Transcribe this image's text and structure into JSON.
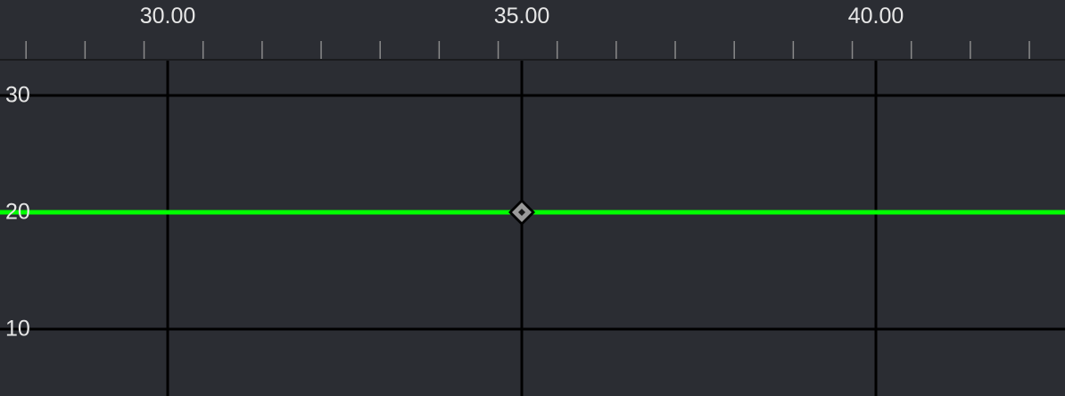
{
  "timeline": {
    "ruler_labels": [
      {
        "frame": 30,
        "text": "30.00"
      },
      {
        "frame": 35,
        "text": "35.00"
      },
      {
        "frame": 40,
        "text": "40.00"
      }
    ],
    "value_labels": [
      {
        "value": 30,
        "text": "30"
      },
      {
        "value": 20,
        "text": "20"
      },
      {
        "value": 10,
        "text": "10"
      }
    ]
  },
  "curve": {
    "color": "#00ff00",
    "value": 20,
    "keyframe": {
      "frame": 35,
      "value": 20,
      "icon": "keyframe-diamond-icon"
    }
  },
  "colors": {
    "background": "#2b2d33",
    "grid": "#000000",
    "tick": "#8a8a8a",
    "major_tick": "#9a9a9a",
    "label": "#e6e6e6",
    "keyframe_fill": "#9a9a9a"
  }
}
